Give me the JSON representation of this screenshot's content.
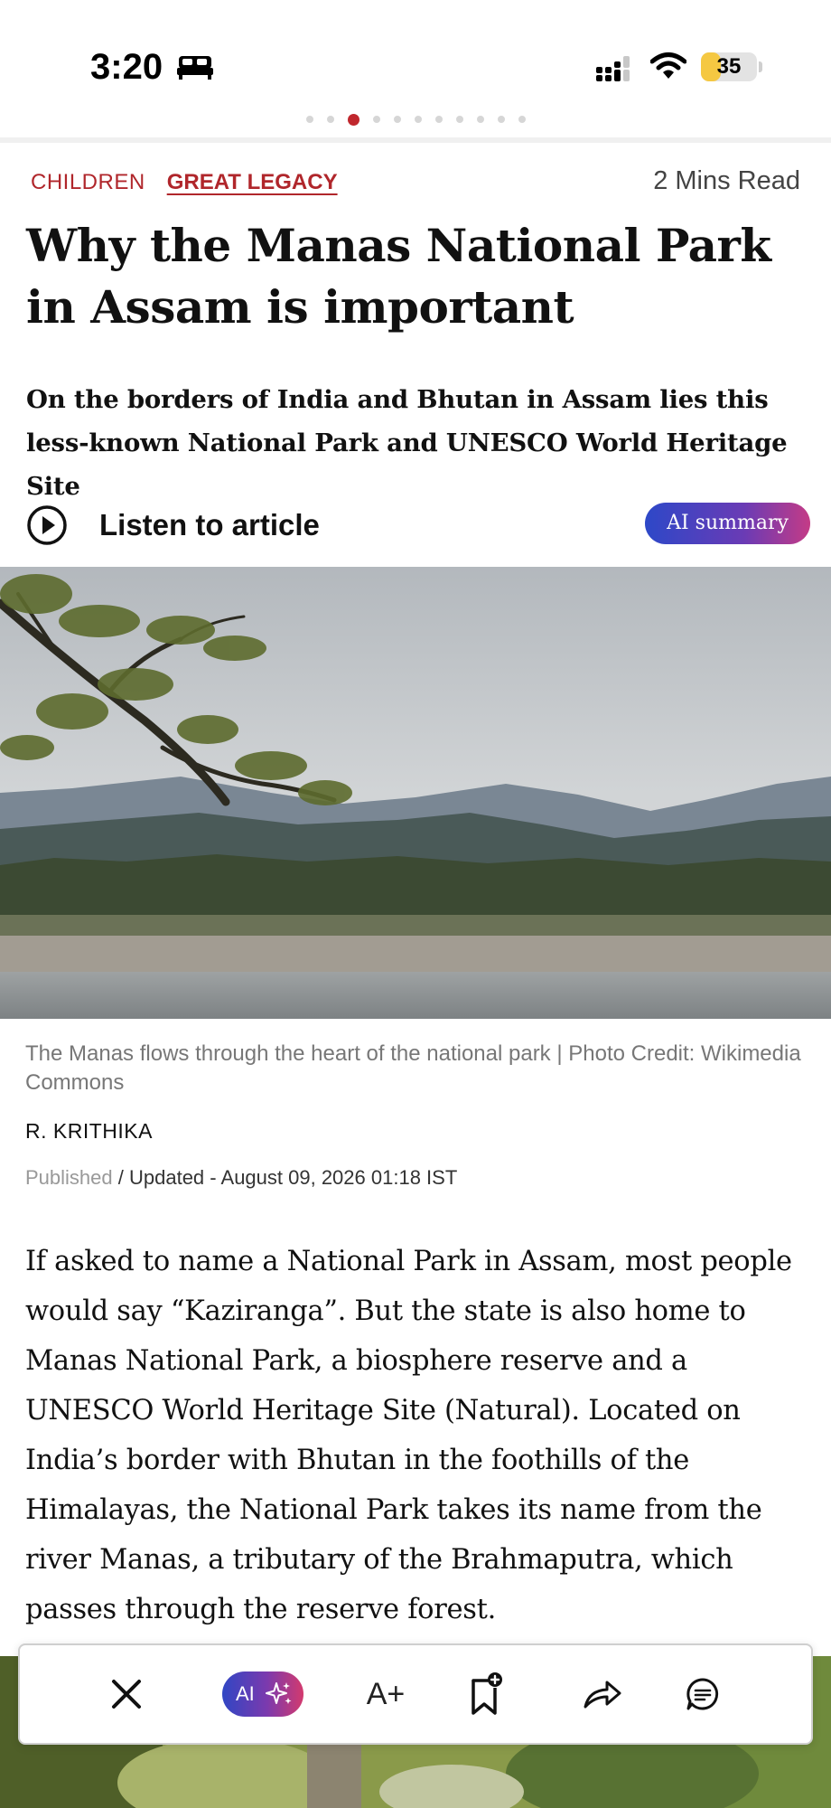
{
  "status_bar": {
    "time": "3:20",
    "battery": "35",
    "battery_level_percent": 35,
    "icons": [
      "bed-icon",
      "cellular-signal-icon",
      "wifi-icon",
      "battery-icon"
    ]
  },
  "pager": {
    "total": 11,
    "active_index": 2
  },
  "article": {
    "section": "CHILDREN",
    "subsection": "GREAT LEGACY",
    "read_time": "2 Mins Read",
    "headline": "Why the Manas National Park in Assam is important",
    "standfirst": "On the borders of India and Bhutan in Assam lies this less-known National Park and UNESCO World Heritage Site",
    "listen_label": "Listen to article",
    "ai_summary_label": "AI summary",
    "image_caption": "The Manas flows through the heart of the national park | Photo Credit: Wikimedia Commons",
    "author": "R. KRITHIKA",
    "published_label": "Published",
    "updated_label": "/ Updated",
    "date": " - August 09, 2026 01:18 IST",
    "body": "If asked to name a National Park in Assam, most people would say “Kaziranga”. But the state is also home to Manas National Park, a biosphere reserve and a UNESCO World Heritage Site (Natural). Located on India’s border with Bhutan in the foothills of the Himalayas, the National Park takes its name from the river Manas, a tributary of the Brahmaputra, which passes through the reserve forest."
  },
  "toolbar": {
    "ai_label": "AI",
    "font_size_label": "A+",
    "icons": [
      "close-icon",
      "sparkle-icon",
      "bookmark-add-icon",
      "share-icon",
      "comment-icon"
    ]
  },
  "colors": {
    "brand_red": "#b0262b",
    "ai_gradient_start": "#2d48c8",
    "ai_gradient_end": "#c43b86",
    "battery_yellow": "#f5c842"
  }
}
